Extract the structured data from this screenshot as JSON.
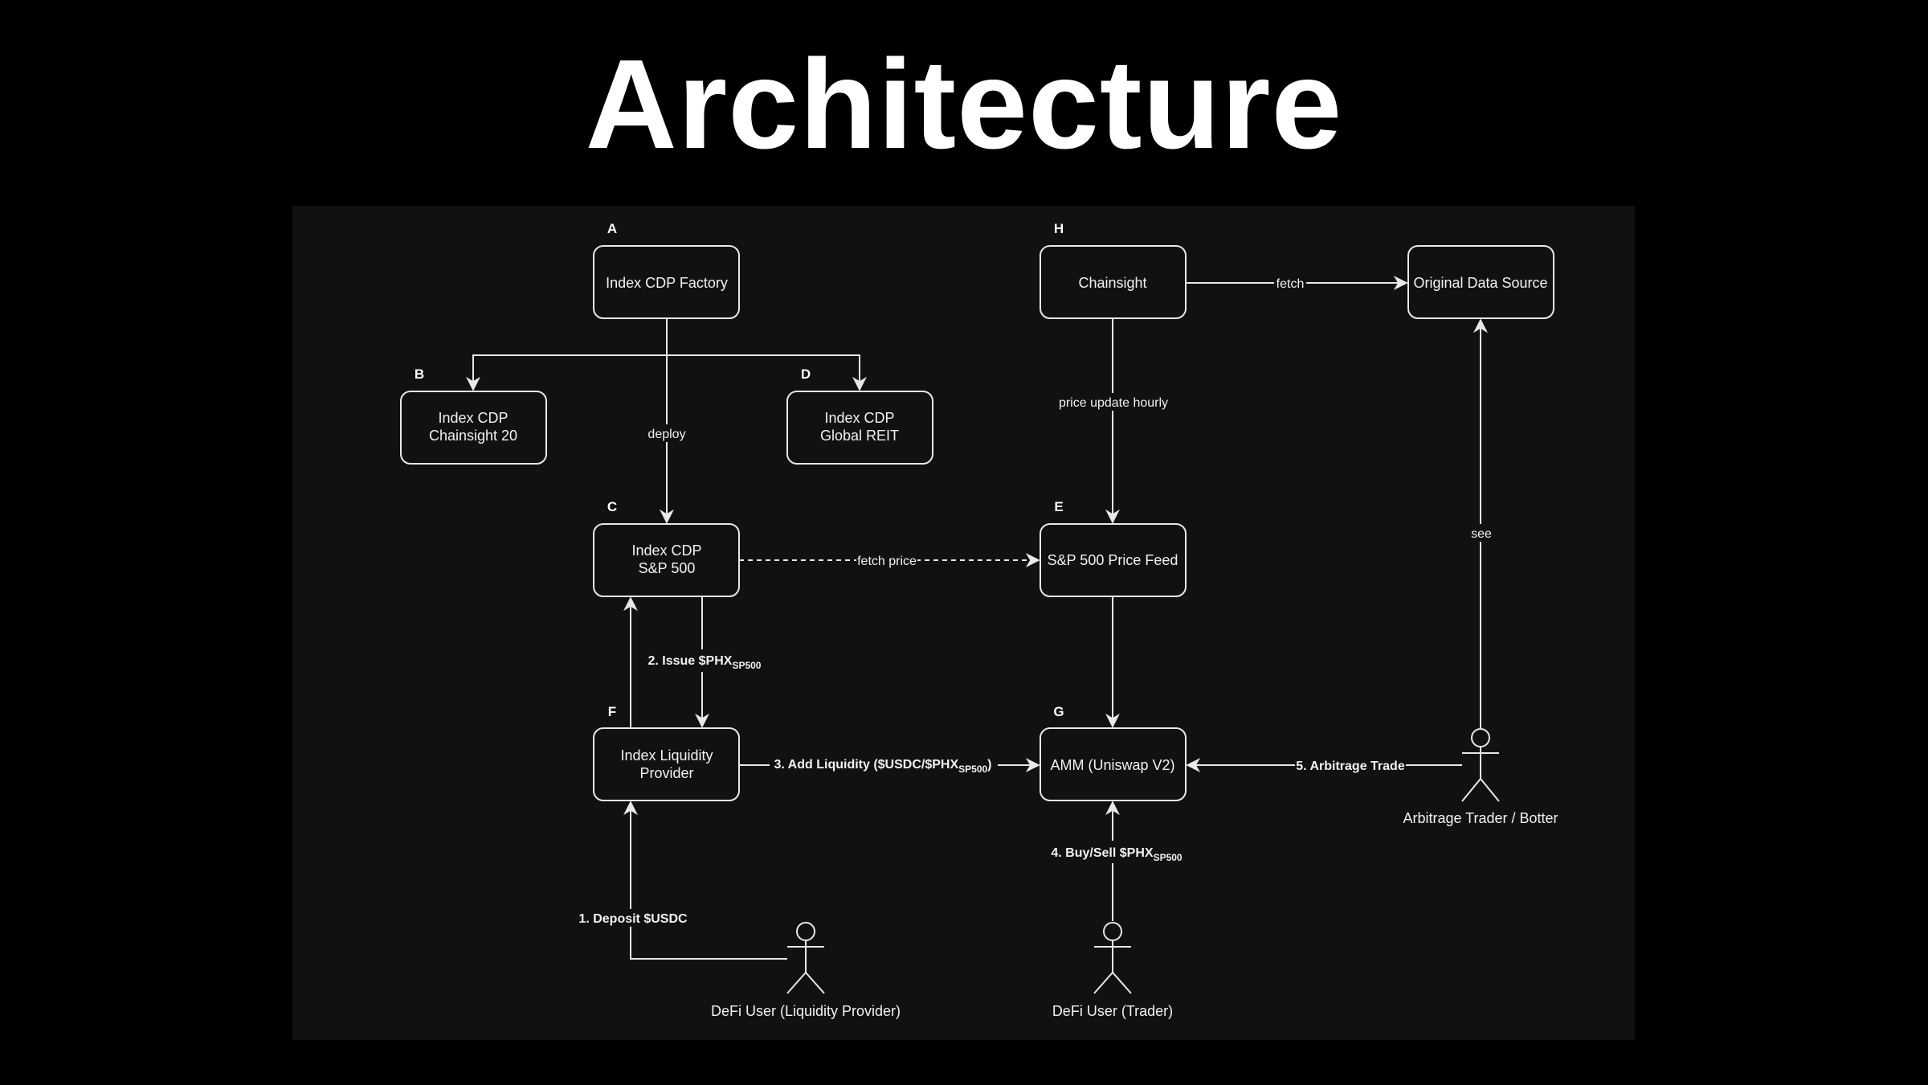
{
  "title": "Architecture",
  "colors": {
    "page_background": "#000000",
    "panel_background": "#111111",
    "stroke": "#e8e8e8",
    "text": "#ffffff"
  },
  "nodes": {
    "A": {
      "letter": "A",
      "line1": "Index CDP Factory"
    },
    "B": {
      "letter": "B",
      "line1": "Index CDP",
      "line2": "Chainsight 20"
    },
    "C": {
      "letter": "C",
      "line1": "Index CDP",
      "line2": "S&P 500"
    },
    "D": {
      "letter": "D",
      "line1": "Index CDP",
      "line2": "Global REIT"
    },
    "E": {
      "letter": "E",
      "line1": "S&P 500 Price Feed"
    },
    "F": {
      "letter": "F",
      "line1": "Index Liquidity",
      "line2": "Provider"
    },
    "G": {
      "letter": "G",
      "line1": "AMM (Uniswap V2)"
    },
    "H": {
      "letter": "H",
      "line1": "Chainsight"
    },
    "source": {
      "line1": "Original Data Source"
    }
  },
  "actors": {
    "lp": "DeFi User (Liquidity Provider)",
    "trader": "DeFi User (Trader)",
    "arb": "Arbitrage Trader / Botter"
  },
  "edges": {
    "deploy": "deploy",
    "fetch": "fetch",
    "price_update": "price update hourly",
    "fetch_price": "fetch price",
    "see": "see",
    "issue": "2. Issue $PHX",
    "issue_sub": "SP500",
    "add_liquidity": "3. Add Liquidity ($USDC/$PHX",
    "add_liquidity_sub": "SP500",
    "add_liquidity_end": ")",
    "buy_sell": "4. Buy/Sell $PHX",
    "buy_sell_sub": "SP500",
    "arbitrage": "5. Arbitrage Trade",
    "deposit": "1. Deposit $USDC"
  }
}
